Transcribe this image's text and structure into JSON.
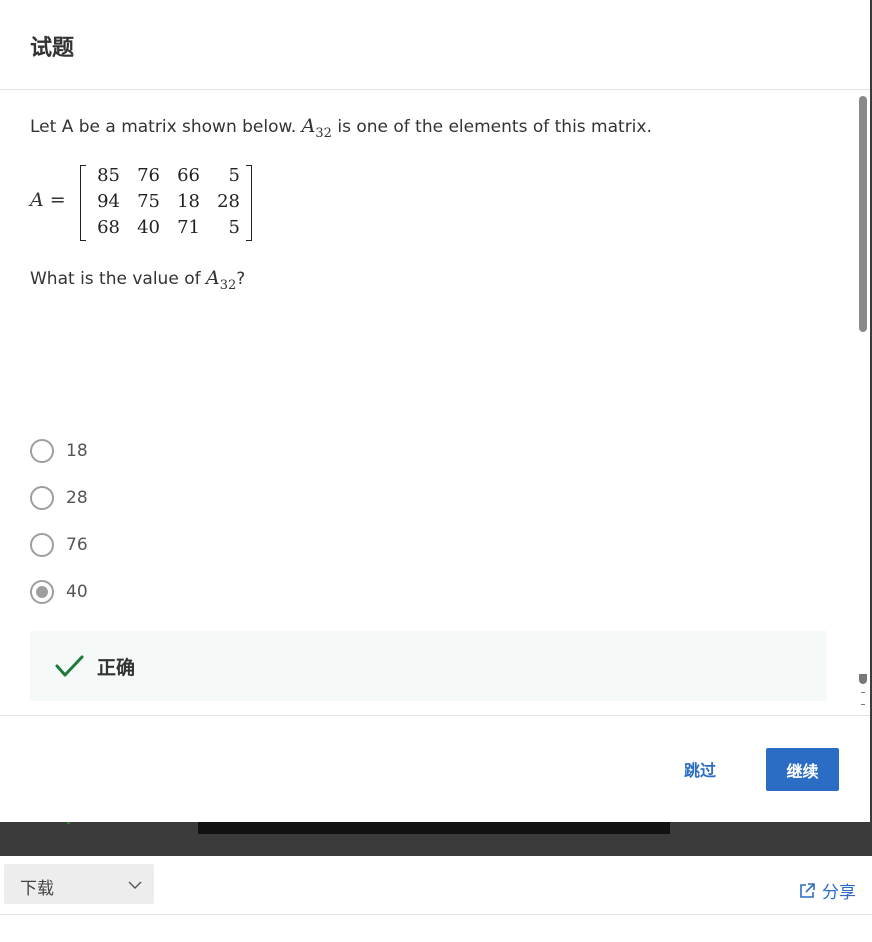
{
  "modal": {
    "title": "试题",
    "question": {
      "prefix": "Let A be a matrix shown below.",
      "element_var": "A",
      "element_sub": "32",
      "suffix": "is one of the elements of this matrix.",
      "matrix_var": "A",
      "matrix_eq": "=",
      "matrix": [
        [
          "85",
          "76",
          "66",
          "5"
        ],
        [
          "94",
          "75",
          "18",
          "28"
        ],
        [
          "68",
          "40",
          "71",
          "5"
        ]
      ],
      "ask_prefix": "What is the value of",
      "ask_var": "A",
      "ask_sub": "32",
      "ask_suffix": "?"
    },
    "options": [
      {
        "label": "18",
        "selected": false
      },
      {
        "label": "28",
        "selected": false
      },
      {
        "label": "76",
        "selected": false
      },
      {
        "label": "40",
        "selected": true
      }
    ],
    "feedback": {
      "label": "正确",
      "icon": "check-icon",
      "color": "#1e7a3c"
    },
    "footer": {
      "skip_label": "跳过",
      "continue_label": "继续"
    }
  },
  "bottom_bar": {
    "download_label": "下载",
    "share_label": "分享"
  },
  "colors": {
    "accent": "#2b6cc4",
    "success": "#1e7a3c"
  }
}
